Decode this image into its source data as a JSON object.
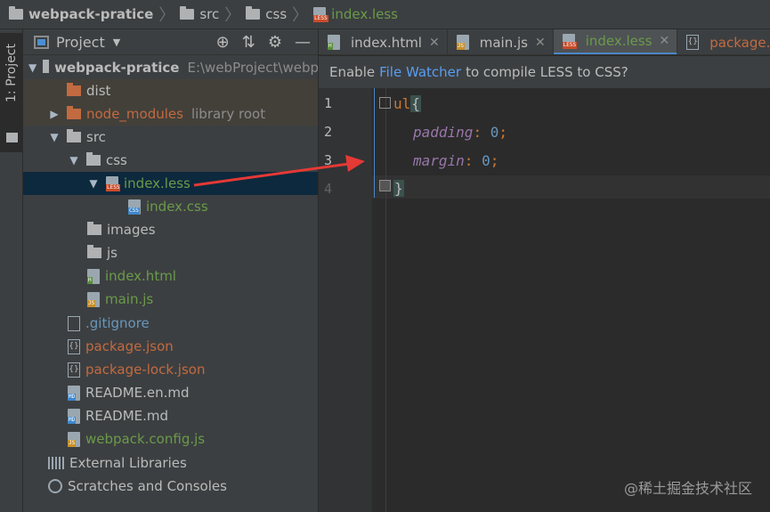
{
  "breadcrumb": [
    {
      "label": "webpack-pratice",
      "icon": "folder-icon"
    },
    {
      "label": "src",
      "icon": "folder-icon"
    },
    {
      "label": "css",
      "icon": "folder-icon"
    },
    {
      "label": "index.less",
      "icon": "less-file-icon"
    }
  ],
  "strip": {
    "tab_label": "1: Project"
  },
  "panel": {
    "title": "Project",
    "tools": {
      "locate": "⊕",
      "collapse": "⇅",
      "settings": "⚙",
      "hide": "—"
    }
  },
  "tree": {
    "root": {
      "name": "webpack-pratice",
      "path": "E:\\webProject\\webp"
    },
    "dist": "dist",
    "node_modules": {
      "name": "node_modules",
      "note": "library root"
    },
    "src": "src",
    "css": "css",
    "index_less": "index.less",
    "index_css": "index.css",
    "images": "images",
    "js": "js",
    "index_html": "index.html",
    "main_js": "main.js",
    "gitignore": ".gitignore",
    "package_json": "package.json",
    "package_lock": "package-lock.json",
    "readme_en": "README.en.md",
    "readme": "README.md",
    "webpack_config": "webpack.config.js",
    "external_libraries": "External Libraries",
    "scratches": "Scratches and Consoles"
  },
  "tabs": [
    {
      "label": "index.html",
      "tag": "H"
    },
    {
      "label": "main.js",
      "tag": "JS"
    },
    {
      "label": "index.less",
      "tag": "LESS"
    },
    {
      "label": "package.json",
      "tag": "{}"
    }
  ],
  "notice": {
    "prefix": "Enable",
    "link": "File Watcher",
    "suffix": "to compile LESS to CSS?"
  },
  "code": {
    "line_numbers": [
      "1",
      "2",
      "3",
      "4"
    ],
    "selector": "ul",
    "open_brace": "{",
    "prop1": "padding",
    "val1": "0",
    "prop2": "margin",
    "val2": "0",
    "close_brace": "}"
  },
  "watermark": "@稀土掘金技术社区",
  "colors": {
    "accent": "#4a88c7",
    "arrow": "#e53935",
    "selection": "#0d293e"
  }
}
